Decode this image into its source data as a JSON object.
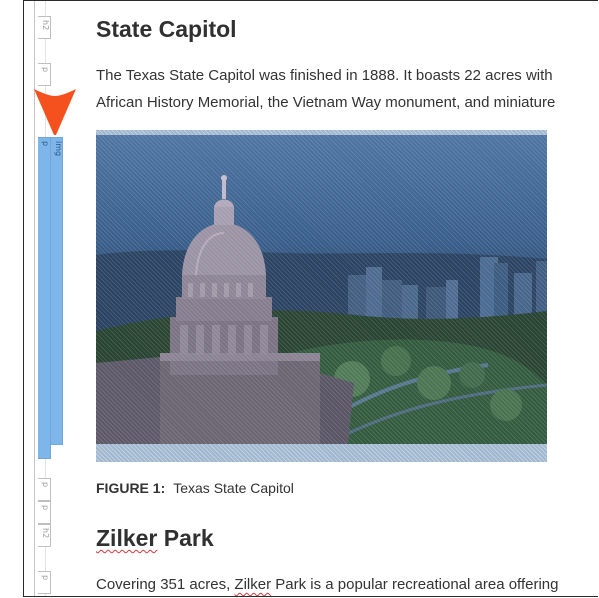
{
  "gutter_tags": [
    {
      "name": "gutter-tag-h2-1",
      "label": "h2"
    },
    {
      "name": "gutter-tag-p-1",
      "label": "p"
    },
    {
      "name": "gutter-tag-p-selected",
      "label": "p"
    },
    {
      "name": "gutter-tag-img-selected",
      "label": "img"
    },
    {
      "name": "gutter-tag-p-2",
      "label": "p"
    },
    {
      "name": "gutter-tag-p-3",
      "label": "p"
    },
    {
      "name": "gutter-tag-h2-2",
      "label": "h2"
    },
    {
      "name": "gutter-tag-p-4",
      "label": "p"
    }
  ],
  "document": {
    "section1": {
      "heading": "State Capitol",
      "paragraph_line1": "The Texas State Capitol was finished in 1888. It boasts 22 acres with",
      "paragraph_line2": "African History Memorial, the Vietnam Way monument, and miniature"
    },
    "figure": {
      "image_alt": "Texas State Capitol dome and downtown skyline",
      "caption_label": "FIGURE 1:",
      "caption_text": "Texas State Capitol"
    },
    "section2": {
      "heading_word1": "Zilker",
      "heading_word2": " Park",
      "paragraph_before": "Covering 351 acres, ",
      "paragraph_link": "Zilker",
      "paragraph_after": " Park is a popular recreational area offering"
    }
  },
  "colors": {
    "selection_blue": "#7eb6ea",
    "arrow_orange": "#f4511e",
    "spellcheck_red": "#d43838"
  }
}
